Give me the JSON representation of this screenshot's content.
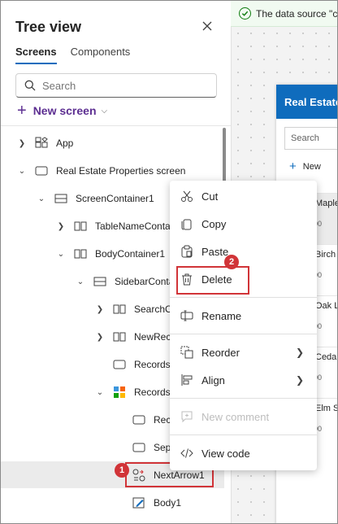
{
  "notification": {
    "text": "The data source \"c"
  },
  "panel": {
    "title": "Tree view",
    "tabs": [
      {
        "label": "Screens"
      },
      {
        "label": "Components"
      }
    ],
    "search": {
      "placeholder": "Search",
      "value": ""
    },
    "new_screen_label": "New screen"
  },
  "tree": [
    {
      "label": "App"
    },
    {
      "label": "Real Estate Properties screen"
    },
    {
      "label": "ScreenContainer1"
    },
    {
      "label": "TableNameContai"
    },
    {
      "label": "BodyContainer1"
    },
    {
      "label": "SidebarConta"
    },
    {
      "label": "SearchCo"
    },
    {
      "label": "NewReco"
    },
    {
      "label": "RecordsL"
    },
    {
      "label": "RecordsG"
    },
    {
      "label": "Rect"
    },
    {
      "label": "Sepa"
    },
    {
      "label": "NextArrow1"
    },
    {
      "label": "Body1"
    }
  ],
  "context_menu": {
    "items": [
      {
        "label": "Cut"
      },
      {
        "label": "Copy"
      },
      {
        "label": "Paste"
      },
      {
        "label": "Delete"
      },
      {
        "label": "Rename"
      },
      {
        "label": "Reorder"
      },
      {
        "label": "Align"
      },
      {
        "label": "New comment"
      },
      {
        "label": "View code"
      }
    ]
  },
  "callouts": [
    "1",
    "2"
  ],
  "app_preview": {
    "header": "Real Estate",
    "search_placeholder": "Search",
    "new_label": "New",
    "rows": [
      {
        "name": "Maple",
        "price": "00"
      },
      {
        "name": "Birch",
        "price": "00"
      },
      {
        "name": "Oak L",
        "price": "00"
      },
      {
        "name": "Cedar",
        "price": "00"
      },
      {
        "name": "Elm S",
        "price": "00"
      }
    ]
  },
  "colors": {
    "accent": "#0f6cbd",
    "callout": "#d13438",
    "new_screen": "#5c2e91"
  }
}
